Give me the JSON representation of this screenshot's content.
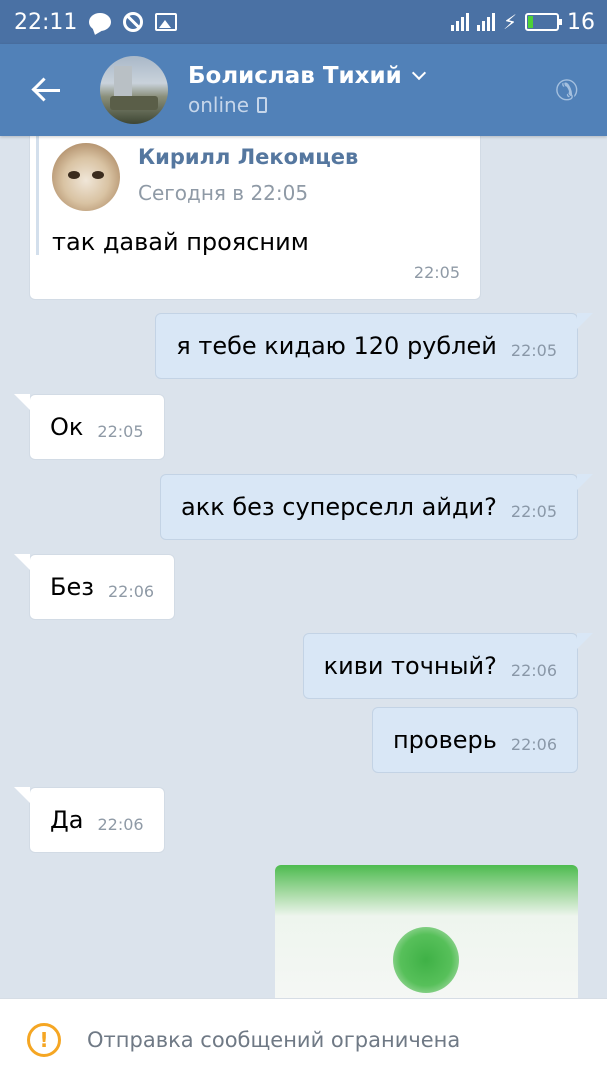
{
  "status_bar": {
    "time": "22:11",
    "battery": "16"
  },
  "header": {
    "name": "Болислав Тихий",
    "status": "online"
  },
  "forwarded": {
    "author": "Кирилл Лекомцев",
    "date": "Сегодня в 22:05",
    "text": "так давай проясним",
    "time": "22:05"
  },
  "messages": [
    {
      "dir": "out",
      "text": "я тебе кидаю 120 рублей",
      "time": "22:05"
    },
    {
      "dir": "in",
      "text": "Ок",
      "time": "22:05"
    },
    {
      "dir": "out",
      "text": "акк без суперселл айди?",
      "time": "22:05"
    },
    {
      "dir": "in",
      "text": "Без",
      "time": "22:06"
    },
    {
      "dir": "out",
      "text": "киви точный?",
      "time": "22:06"
    },
    {
      "dir": "out",
      "text": "проверь",
      "time": "22:06"
    },
    {
      "dir": "in",
      "text": "Да",
      "time": "22:06"
    }
  ],
  "footer": {
    "notice": "Отправка сообщений ограничена"
  },
  "colors": {
    "header": "#5181b8",
    "status_bar": "#4a71a4",
    "out_bubble": "#d9e7f6",
    "warning": "#f5a623"
  }
}
